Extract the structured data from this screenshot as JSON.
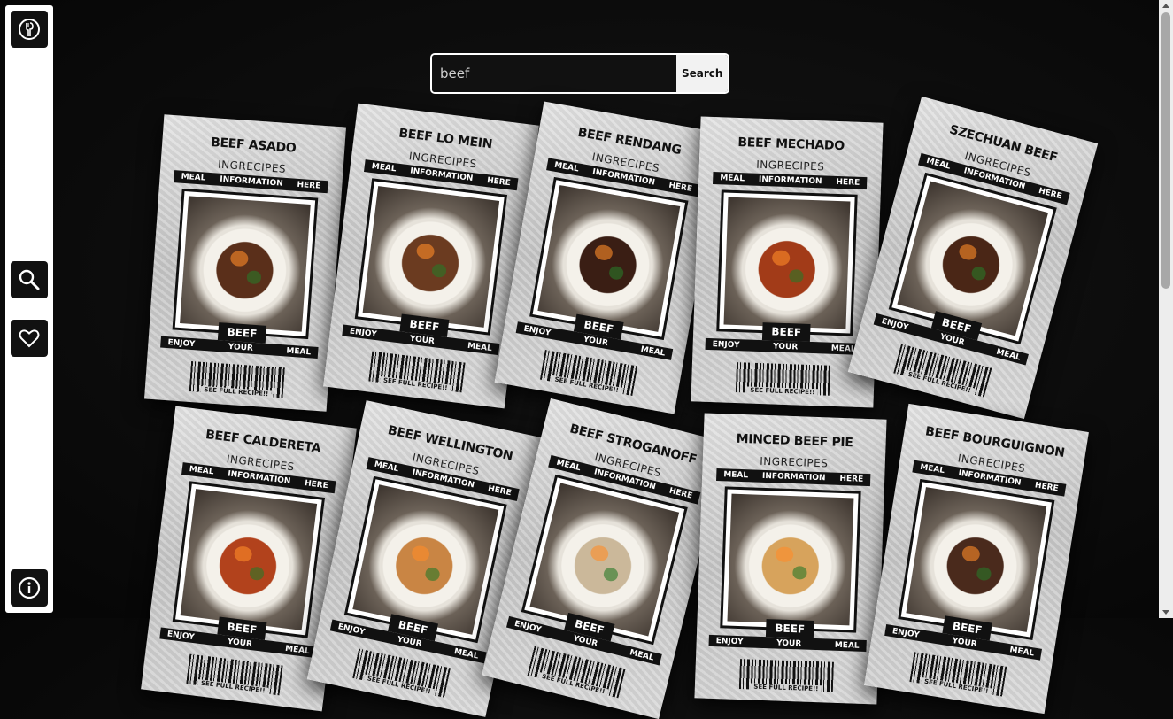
{
  "sidebar": {
    "logo_icon": "fork-spoon-logo-icon",
    "buttons": [
      {
        "name": "search-icon"
      },
      {
        "name": "heart-icon"
      },
      {
        "name": "info-icon"
      }
    ]
  },
  "search": {
    "value": "beef",
    "button_label": "Search"
  },
  "card_text": {
    "subtitle": "INGRECIPES",
    "bar_left": "MEAL",
    "bar_mid": "INFORMATION",
    "bar_right": "HERE",
    "bottom_left": "ENJOY",
    "bottom_mid": "YOUR",
    "bottom_right": "MEAL",
    "see_full": "SEE FULL RECIPE!!"
  },
  "cards": [
    {
      "title": "BEEF ASADO",
      "category": "BEEF",
      "accent": "#5a2f1a"
    },
    {
      "title": "BEEF LO MEIN",
      "category": "BEEF",
      "accent": "#6b3b20"
    },
    {
      "title": "BEEF RENDANG",
      "category": "BEEF",
      "accent": "#3a1e14"
    },
    {
      "title": "BEEF MECHADO",
      "category": "BEEF",
      "accent": "#a23b18"
    },
    {
      "title": "SZECHUAN BEEF",
      "category": "BEEF",
      "accent": "#4a2616"
    },
    {
      "title": "BEEF CALDERETA",
      "category": "BEEF",
      "accent": "#b2421c"
    },
    {
      "title": "BEEF WELLINGTON",
      "category": "BEEF",
      "accent": "#c98544"
    },
    {
      "title": "BEEF STROGANOFF",
      "category": "BEEF",
      "accent": "#cbb89a"
    },
    {
      "title": "MINCED BEEF PIE",
      "category": "BEEF",
      "accent": "#d7a35c"
    },
    {
      "title": "BEEF BOURGUIGNON",
      "category": "BEEF",
      "accent": "#4a2a1c"
    }
  ]
}
